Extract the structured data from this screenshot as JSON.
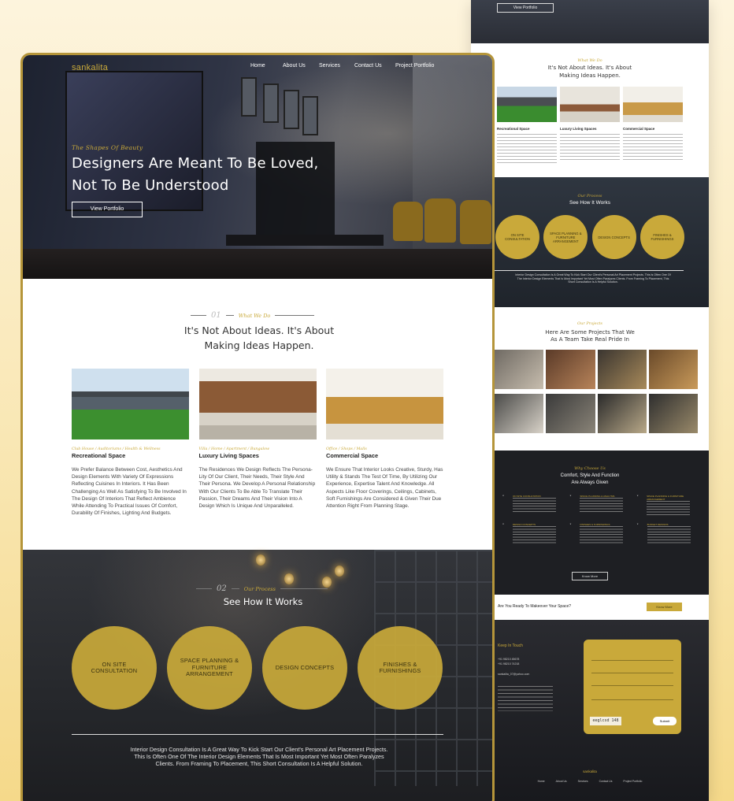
{
  "brand": "sankalita",
  "nav": [
    "Home",
    "About Us",
    "Services",
    "Contact Us",
    "Project Portfolio"
  ],
  "hero": {
    "tagline": "The Shapes Of Beauty",
    "headline_1": "Designers Are Meant To Be Loved,",
    "headline_2": "Not To Be Understood",
    "button": "View Portfolio"
  },
  "about": {
    "number": "01",
    "label": "What We Do",
    "heading_1": "It's Not About Ideas. It's About",
    "heading_2": "Making Ideas Happen.",
    "cards": [
      {
        "category": "Club House / Auditoriums / Health & Wellness",
        "title": "Recreational Space",
        "desc": "We Prefer Balance Between Cost, Aesthetics And Design Elements With Variety Of Expressions Reflecting Cuisines In Interiors. It Has Been Challenging As Well As Satisfying To Be Involved In The Design Of Interiors That Reflect Ambience While Attending To Practical Issues Of Comfort, Durability Of Finishes, Lighting And Budgets."
      },
      {
        "category": "Villa / Home / Apartment / Bungalow",
        "title": "Luxury Living Spaces",
        "desc": "The Residences We Design Reflects The Persona-Lity Of Our Client, Their Needs, Their Style And Their Persona. We Develop A Personal Relationship With Our Clients To Be Able To Translate Their Passion, Their Dreams And Their Vision Into A Design Which Is Unique And Unparalleled."
      },
      {
        "category": "Office / Shops / Malls",
        "title": "Commercial Space",
        "desc": "We Ensure That Interior Looks Creative, Sturdy, Has Utility & Stands The Test Of Time, By Utilizing Our Experience, Expertise Talent And Knowledge. All Aspects Like Floor Coverings, Ceilings, Cabinets, Soft Furnishings Are Considered & Given Their Due Attention Right From Planning Stage."
      }
    ]
  },
  "process": {
    "number": "02",
    "label": "Our Process",
    "heading": "See How It Works",
    "steps": [
      "ON SITE CONSULTATION",
      "SPACE PLANNING & FURNITURE ARRANGEMENT",
      "DESIGN CONCEPTS",
      "FINISHES & FURNISHINGS"
    ],
    "text": "Interior Design Consultation Is A Great Way To Kick Start Our Client's Personal Art Placement Projects. This Is Often One Of The Interior Design Elements That Is Most Important Yet Most Often Paralyzes Clients. From Framing To Placement, This Short Consultation Is A Helpful Solution."
  },
  "side": {
    "hero_button": "View Portfolio",
    "about_label": "What We Do",
    "about_heading_1": "It's Not About Ideas. It's About",
    "about_heading_2": "Making Ideas Happen.",
    "card_titles": [
      "Recreational Space",
      "Luxury Living Spaces",
      "Commercial Space"
    ],
    "process_label": "Our Process",
    "process_heading": "See How It Works",
    "steps": [
      "ON SITE CONSULTATION",
      "SPACE PLANNING & FURNITURE ARRANGEMENT",
      "DESIGN CONCEPTS",
      "FINISHES & FURNISHINGS"
    ],
    "projects_label": "Our Projects",
    "projects_heading_1": "Here Are Some Projects That We",
    "projects_heading_2": "As A Team Take Real Pride In",
    "why_label": "Why Choose Us",
    "why_heading_1": "Comfort, Style And Function",
    "why_heading_2": "Are Always Given",
    "why_items": [
      "ON SITE CONSULTATION",
      "SPACE PLANNING & ANALYSIS",
      "SPACE PLANNING & FURNITURE ARRANGEMENT",
      "DESIGN CONCEPTS",
      "FINISHES & FURNISHINGS",
      "BUDGET DESIGNS"
    ],
    "know_more": "Know More",
    "cta_question": "Are You Ready To Makeover Your Space?",
    "cta_button": "Know More",
    "keep_in_touch": "Keep In Touch",
    "phone_1": "+91 98210 45678",
    "phone_2": "+91 98210 74218",
    "email": "sankalita_07@yahoo.com",
    "captcha": "eeglcsd 148",
    "submit": "Submit",
    "footer_brand": "sankalita",
    "footer_nav": [
      "Home",
      "About Us",
      "Services",
      "Contact Us",
      "Project Portfolio"
    ]
  }
}
